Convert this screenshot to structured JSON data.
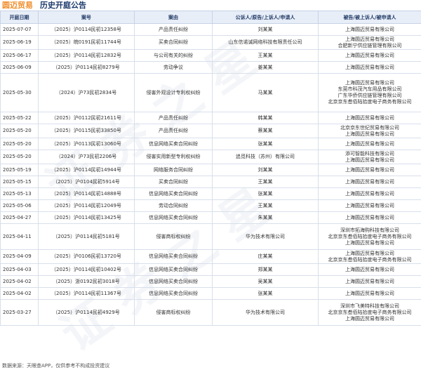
{
  "header": {
    "brand": "圆迈贸易",
    "title": "历史开庭公告"
  },
  "columns": [
    "开庭日期",
    "案号",
    "案由",
    "公诉人/原告/上诉人/申请人",
    "被告/被上诉人/被申请人"
  ],
  "rows": [
    {
      "date": "2025-07-07",
      "case_no": "（2025）沪0114民初12358号",
      "cause": "产品责任纠纷",
      "plaintiff": [
        "刘某某"
      ],
      "defendant": [
        "上海圆迈贸易有限公司"
      ]
    },
    {
      "date": "2025-06-19",
      "case_no": "（2025）皖0191民初11744号",
      "cause": "买卖合同纠纷",
      "plaintiff": [
        "山东信诺诚网络科技有限责任公司"
      ],
      "defendant": [
        "上海圆迈贸易有限公司",
        "合肥新宁供应链管理有限公司"
      ]
    },
    {
      "date": "2025-06-17",
      "case_no": "（2025）沪0114民初12832号",
      "cause": "与公司有关的纠纷",
      "plaintiff": [
        "王某某"
      ],
      "defendant": [
        "上海圆迈贸易有限公司"
      ]
    },
    {
      "date": "2025-06-09",
      "case_no": "（2025）沪0114民初8279号",
      "cause": "劳动争议",
      "plaintiff": [
        "姜某某"
      ],
      "defendant": [
        "上海圆迈贸易有限公司"
      ]
    },
    {
      "date": "2025-05-30",
      "case_no": "（2024）沪73民初2834号",
      "cause": "侵害外观设计专利权纠纷",
      "plaintiff": [
        "马某某"
      ],
      "defendant": [
        "上海圆迈贸易有限公司",
        "东莞市科茂汽车用品有限公司",
        "广东华侨供应链管理有限公司",
        "北京京东叁佰陆拾度电子商务有限公司"
      ]
    },
    {
      "date": "2025-05-22",
      "case_no": "（2025）沪0112民初21611号",
      "cause": "产品责任纠纷",
      "plaintiff": [
        "韩某某"
      ],
      "defendant": [
        "上海圆迈贸易有限公司"
      ]
    },
    {
      "date": "2025-05-20",
      "case_no": "（2025）沪0115民初33850号",
      "cause": "产品责任纠纷",
      "plaintiff": [
        "蔡某某"
      ],
      "defendant": [
        "北京京东世纪贸易有限公司",
        "上海圆迈贸易有限公司"
      ]
    },
    {
      "date": "2025-05-20",
      "case_no": "（2025）沪0113民初13060号",
      "cause": "信息网络买卖合同纠纷",
      "plaintiff": [
        "张某某"
      ],
      "defendant": [
        "上海圆迈贸易有限公司"
      ]
    },
    {
      "date": "2025-05-20",
      "case_no": "（2024）沪73民初2206号",
      "cause": "侵害实用新型专利权纠纷",
      "plaintiff": [
        "追觅科技（苏州）有限公司"
      ],
      "defendant": [
        "添可智能科技有限公司",
        "上海圆迈贸易有限公司"
      ]
    },
    {
      "date": "2025-05-19",
      "case_no": "（2025）沪0114民初14944号",
      "cause": "网络服务合同纠纷",
      "plaintiff": [
        "刘某某"
      ],
      "defendant": [
        "上海圆迈贸易有限公司"
      ]
    },
    {
      "date": "2025-05-15",
      "case_no": "（2025）沪0104民初5914号",
      "cause": "买卖合同纠纷",
      "plaintiff": [
        "王某某"
      ],
      "defendant": [
        "上海圆迈贸易有限公司"
      ]
    },
    {
      "date": "2025-05-13",
      "case_no": "（2025）沪0114民初14888号",
      "cause": "信息网络买卖合同纠纷",
      "plaintiff": [
        "张某某"
      ],
      "defendant": [
        "上海圆迈贸易有限公司"
      ]
    },
    {
      "date": "2025-05-06",
      "case_no": "（2025）沪0114民初12049号",
      "cause": "劳动合同纠纷",
      "plaintiff": [
        "王某某"
      ],
      "defendant": [
        "上海圆迈贸易有限公司"
      ]
    },
    {
      "date": "2025-04-27",
      "case_no": "（2025）沪0114民初13425号",
      "cause": "信息网络买卖合同纠纷",
      "plaintiff": [
        "朱某某"
      ],
      "defendant": [
        "上海圆迈贸易有限公司"
      ]
    },
    {
      "date": "2025-04-11",
      "case_no": "（2025）沪0114民初5181号",
      "cause": "侵害商标权纠纷",
      "plaintiff": [
        "华为技术有限公司"
      ],
      "defendant": [
        "深圳市拓海购科技有限公司",
        "北京京东叁佰陆拾度电子商务有限公司",
        "上海圆迈贸易有限公司"
      ]
    },
    {
      "date": "2025-04-09",
      "case_no": "（2025）沪0106民初13720号",
      "cause": "信息网络买卖合同纠纷",
      "plaintiff": [
        "庄某某"
      ],
      "defendant": [
        "上海圆迈贸易有限公司",
        "北京京东叁佰陆拾度电子商务有限公司"
      ]
    },
    {
      "date": "2025-04-03",
      "case_no": "（2025）沪0114民初10402号",
      "cause": "信息网络买卖合同纠纷",
      "plaintiff": [
        "郑某某"
      ],
      "defendant": [
        "上海圆迈贸易有限公司"
      ]
    },
    {
      "date": "2025-04-02",
      "case_no": "（2025）浙0192民初3018号",
      "cause": "信息网络买卖合同纠纷",
      "plaintiff": [
        "吴某某"
      ],
      "defendant": [
        "上海圆迈贸易有限公司"
      ]
    },
    {
      "date": "2025-04-02",
      "case_no": "（2025）沪0114民初11367号",
      "cause": "信息网络买卖合同纠纷",
      "plaintiff": [
        "张某某"
      ],
      "defendant": [
        "上海圆迈贸易有限公司"
      ]
    },
    {
      "date": "2025-03-27",
      "case_no": "（2025）沪0114民初4929号",
      "cause": "侵害商标权纠纷",
      "plaintiff": [
        "华为技术有限公司"
      ],
      "defendant": [
        "深圳市飞美特科技有限公司",
        "北京京东叁佰陆拾度电子商务有限公司",
        "上海圆迈贸易有限公司"
      ]
    }
  ],
  "footer": "数据来源：天眼查APP，仅供参考不构成投资建议",
  "colors": {
    "brand": "#f08d2a",
    "title": "#1c3a6b",
    "header_bg": "#e8eef8"
  }
}
